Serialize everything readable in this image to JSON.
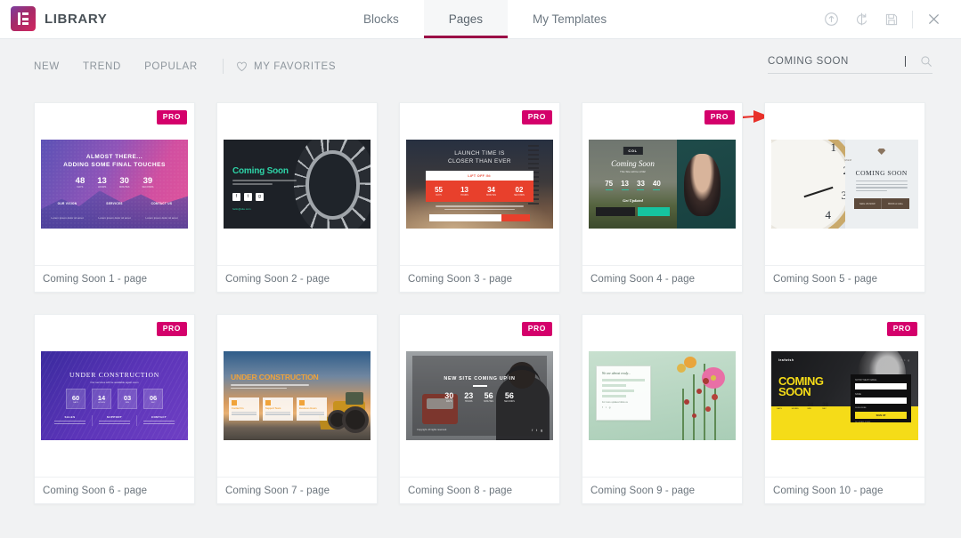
{
  "header": {
    "brand_title": "LIBRARY",
    "logo_icon": "elementor-logo-icon",
    "tabs": [
      {
        "label": "Blocks",
        "active": false
      },
      {
        "label": "Pages",
        "active": true
      },
      {
        "label": "My Templates",
        "active": false
      }
    ],
    "actions": [
      {
        "name": "upload-icon",
        "label": "Upload"
      },
      {
        "name": "sync-icon",
        "label": "Sync Library"
      },
      {
        "name": "save-icon",
        "label": "Save"
      },
      {
        "name": "close-icon",
        "label": "Close"
      }
    ]
  },
  "filters": {
    "items": [
      {
        "label": "NEW"
      },
      {
        "label": "TREND"
      },
      {
        "label": "POPULAR"
      }
    ],
    "favorites_label": "MY FAVORITES",
    "favorites_icon": "heart-icon"
  },
  "search": {
    "value": "COMING SOON",
    "placeholder": "Search",
    "icon": "search-icon"
  },
  "annotation": {
    "arrow_color": "#e8312a",
    "points_to": "search-input"
  },
  "badges": {
    "pro_label": "PRO",
    "pro_color": "#d4006b"
  },
  "templates": [
    {
      "label": "Coming Soon 1 - page",
      "pro": true,
      "thumb": {
        "style": "th1",
        "heading1": "ALMOST THERE...",
        "heading2": "ADDING SOME FINAL TOUCHES",
        "counters": [
          {
            "value": "48",
            "unit": "DAYS"
          },
          {
            "value": "13",
            "unit": "HOURS"
          },
          {
            "value": "30",
            "unit": "MINUTES"
          },
          {
            "value": "39",
            "unit": "SECONDS"
          }
        ],
        "columns": [
          "OUR VISION",
          "SERVICES",
          "CONTACT US"
        ]
      }
    },
    {
      "label": "Coming Soon 2 - page",
      "pro": false,
      "thumb": {
        "style": "th2",
        "heading1": "Coming Soon",
        "mail": "hello@site.com"
      }
    },
    {
      "label": "Coming Soon 3 - page",
      "pro": true,
      "thumb": {
        "style": "th3",
        "heading1": "LAUNCH TIME IS",
        "heading2": "CLOSER THAN EVER",
        "liftoff_label": "LIFT OFF IN:",
        "counters": [
          {
            "value": "55",
            "unit": "DAYS"
          },
          {
            "value": "13",
            "unit": "HOURS"
          },
          {
            "value": "34",
            "unit": "MINUTES"
          },
          {
            "value": "02",
            "unit": "SECONDS"
          }
        ]
      }
    },
    {
      "label": "Coming Soon 4 - page",
      "pro": true,
      "thumb": {
        "style": "th4",
        "tag": "COL",
        "heading1": "Coming Soon",
        "subtitle": "This Site will be LIVE!",
        "counters": [
          {
            "value": "75",
            "unit": "DAYS"
          },
          {
            "value": "13",
            "unit": "HOURS"
          },
          {
            "value": "33",
            "unit": "MIN"
          },
          {
            "value": "40",
            "unit": "SEC"
          }
        ],
        "cta_heading": "Get Updated",
        "button_label": "NOTIFY ME"
      }
    },
    {
      "label": "Coming Soon 5 - page",
      "pro": false,
      "thumb": {
        "style": "th5",
        "brand": "M&M",
        "heading1": "COMING SOON",
        "buttons": [
          "MAIL US NOW",
          "BOOK A CALL"
        ]
      }
    },
    {
      "label": "Coming Soon 6 - page",
      "pro": true,
      "thumb": {
        "style": "th6",
        "heading1": "UNDER CONSTRUCTION",
        "subtitle": "Our services will be available again soon",
        "counters": [
          {
            "value": "60",
            "unit": "DAYS"
          },
          {
            "value": "14",
            "unit": "HOURS"
          },
          {
            "value": "03",
            "unit": "MIN"
          },
          {
            "value": "06",
            "unit": "SEC"
          }
        ],
        "columns": [
          "SALES",
          "SUPPORT",
          "CONTACT"
        ]
      }
    },
    {
      "label": "Coming Soon 7 - page",
      "pro": false,
      "thumb": {
        "style": "th7",
        "heading1": "UNDER CONSTRUCTION",
        "cards": [
          "Contact Us",
          "Support Team",
          "Business Hours"
        ]
      }
    },
    {
      "label": "Coming Soon 8 - page",
      "pro": true,
      "thumb": {
        "style": "th8",
        "heading1": "NEW SITE COMING UP IN",
        "counters": [
          {
            "value": "30",
            "unit": "DAYS"
          },
          {
            "value": "23",
            "unit": "HOURS"
          },
          {
            "value": "56",
            "unit": "MINUTES"
          },
          {
            "value": "56",
            "unit": "SECONDS"
          }
        ],
        "footer": "Copyright. All rights reserved."
      }
    },
    {
      "label": "Coming Soon 9 - page",
      "pro": false,
      "thumb": {
        "style": "th9",
        "heading1": "We are almost ready...",
        "footer": "For more updates follow us"
      }
    },
    {
      "label": "Coming Soon 10 - page",
      "pro": true,
      "thumb": {
        "style": "th10",
        "logo": "leafwish",
        "heading1": "COMING",
        "heading2": "SOON",
        "counters": [
          {
            "value": "98",
            "unit": "DAYS"
          },
          {
            "value": "23",
            "unit": "HOURS"
          },
          {
            "value": "24",
            "unit": "MIN"
          },
          {
            "value": "38",
            "unit": "SEC"
          }
        ],
        "form_label": "NOTIFY ME BY EMAIL",
        "form_label2": "NAME",
        "form_check": "SUBSCRIBE",
        "button_label": "SIGN UP",
        "form_footer": "NO SPAM. EVER."
      }
    }
  ]
}
